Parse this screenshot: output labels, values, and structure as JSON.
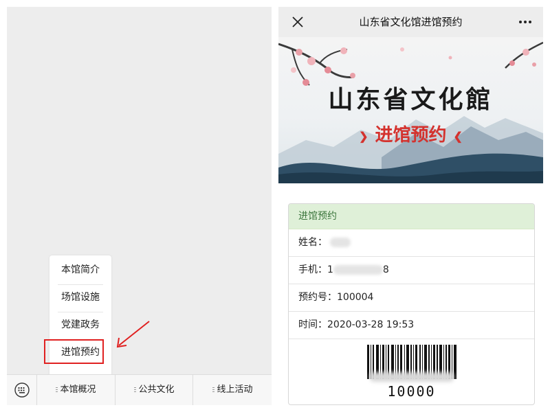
{
  "left_phone": {
    "popup_menu": {
      "items": [
        "本馆简介",
        "场馆设施",
        "党建政务",
        "进馆预约"
      ]
    },
    "bottom_menu": {
      "tabs": [
        "本馆概况",
        "公共文化",
        "线上活动"
      ]
    }
  },
  "right_phone": {
    "title": "山东省文化馆进馆预约",
    "banner": {
      "title": "山东省文化館",
      "subtitle": "进馆预约"
    },
    "card": {
      "header": "进馆预约",
      "name_label": "姓名：",
      "phone_label": "手机：",
      "phone_start": "1",
      "phone_end": "8",
      "booking_label": "预约号：",
      "booking_value": "100004",
      "time_label": "时间：",
      "time_value": "2020-03-28 19:53",
      "barcode_text": "10000"
    }
  },
  "colors": {
    "highlight": "#e02020",
    "card_header_bg": "#dff0d8",
    "card_header_text": "#3c763d",
    "banner_subtitle": "#d4322e"
  },
  "icons": [
    "keyboard-icon",
    "close-icon",
    "more-icon",
    "arrow-annotation"
  ]
}
